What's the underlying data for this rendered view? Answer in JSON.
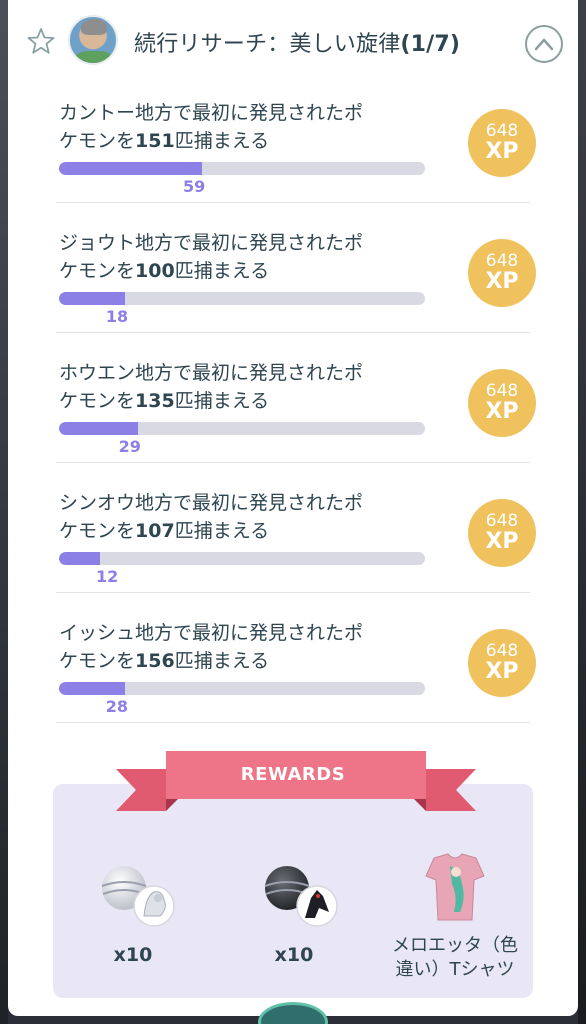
{
  "header": {
    "title": "続行リサーチ：美しい旋律",
    "count": "(1/7)"
  },
  "tasks": [
    {
      "line1": "カントー地方で最初に発見されたポ",
      "line2_prefix": "ケモンを",
      "line2_num": "151",
      "line2_suffix": "匹捕まえる",
      "progress": 59,
      "goal": 151,
      "xp_value": "648",
      "xp_unit": "XP"
    },
    {
      "line1": "ジョウト地方で最初に発見されたポ",
      "line2_prefix": "ケモンを",
      "line2_num": "100",
      "line2_suffix": "匹捕まえる",
      "progress": 18,
      "goal": 100,
      "xp_value": "648",
      "xp_unit": "XP"
    },
    {
      "line1": "ホウエン地方で最初に発見されたポ",
      "line2_prefix": "ケモンを",
      "line2_num": "135",
      "line2_suffix": "匹捕まえる",
      "progress": 29,
      "goal": 135,
      "xp_value": "648",
      "xp_unit": "XP"
    },
    {
      "line1": "シンオウ地方で最初に発見されたポ",
      "line2_prefix": "ケモンを",
      "line2_num": "107",
      "line2_suffix": "匹捕まえる",
      "progress": 12,
      "goal": 107,
      "xp_value": "648",
      "xp_unit": "XP"
    },
    {
      "line1": "イッシュ地方で最初に発見されたポ",
      "line2_prefix": "ケモンを",
      "line2_num": "156",
      "line2_suffix": "匹捕まえる",
      "progress": 28,
      "goal": 156,
      "xp_value": "648",
      "xp_unit": "XP"
    }
  ],
  "rewards": {
    "title": "REWARDS",
    "items": [
      {
        "icon": "reshiram-encounter-icon",
        "label": "x10"
      },
      {
        "icon": "zekrom-encounter-icon",
        "label": "x10"
      },
      {
        "icon": "meloetta-shiny-tshirt-icon",
        "label_line1": "メロエッタ（色",
        "label_line2": "違い）Tシャツ"
      }
    ]
  },
  "colors": {
    "progress_fill": "#8c7fe6",
    "progress_track": "#d8d9e3",
    "xp_badge": "#efc25e",
    "ribbon": "#e9697d",
    "rewards_bg": "#e9e7f6",
    "text": "#2f4550"
  }
}
